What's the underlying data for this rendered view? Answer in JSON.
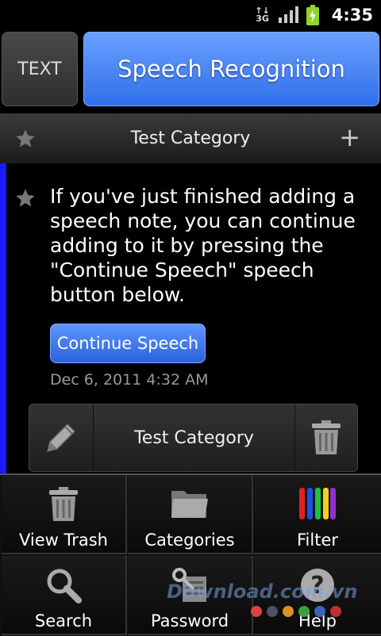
{
  "status_bar": {
    "network": "3G",
    "time": "4:35"
  },
  "header": {
    "text_button": "TEXT",
    "speech_button": "Speech Recognition"
  },
  "category_bar": {
    "title": "Test Category",
    "add": "+"
  },
  "note": {
    "body": "If you've just finished adding a speech note, you can continue adding to it by pressing the \"Continue Speech\" speech button below.",
    "continue_button": "Continue Speech",
    "date": "Dec 6, 2011 4:32 AM",
    "category": "Test Category",
    "accent_color": "#1a1aff"
  },
  "menu": {
    "items": [
      {
        "label": "View Trash",
        "icon": "trash-icon"
      },
      {
        "label": "Categories",
        "icon": "folder-icon"
      },
      {
        "label": "Filter",
        "icon": "color-bars-icon"
      },
      {
        "label": "Search",
        "icon": "magnifier-icon"
      },
      {
        "label": "Password",
        "icon": "key-icon"
      },
      {
        "label": "Help",
        "icon": "question-icon"
      }
    ]
  },
  "watermark": "Download.com.vn"
}
